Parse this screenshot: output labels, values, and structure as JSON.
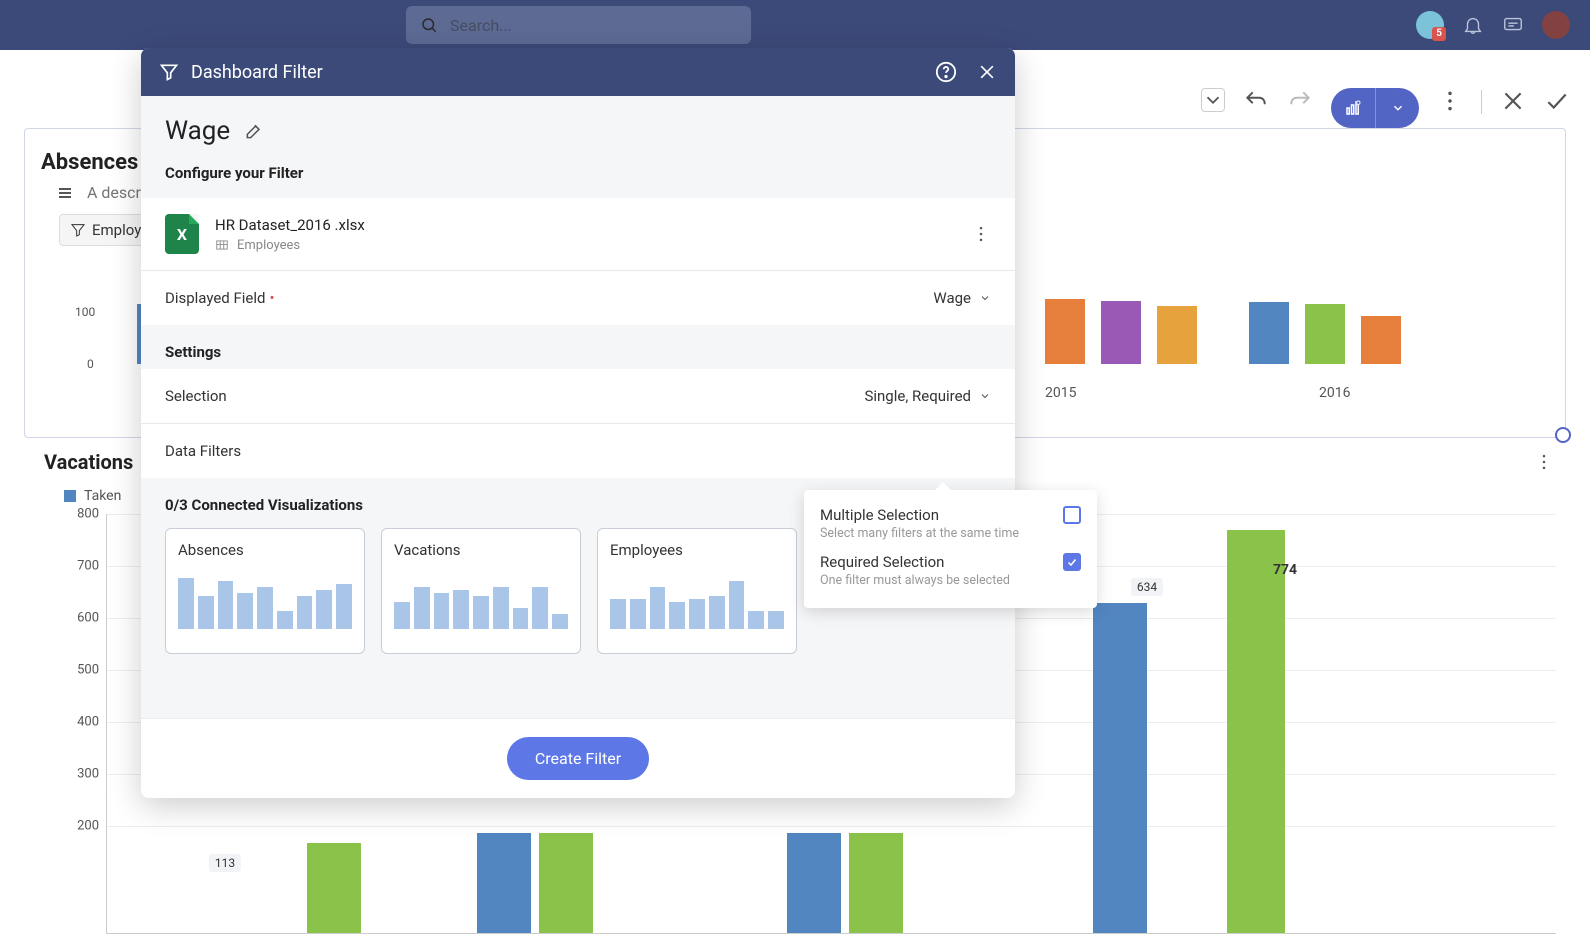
{
  "topbar": {
    "search_placeholder": "Search...",
    "badge_count": "5"
  },
  "editor_toolbar": {},
  "background": {
    "absences_title": "Absences",
    "description_placeholder": "A descrip",
    "chip_label": "Employee",
    "y100": "100",
    "y0": "0",
    "year_2015": "2015",
    "year_2016": "2016"
  },
  "vacations": {
    "title": "Vacations",
    "legend_taken": "Taken",
    "yticks": [
      "800",
      "700",
      "600",
      "500",
      "400",
      "300",
      "200"
    ],
    "label_113": "113",
    "label_634": "634",
    "label_774": "774"
  },
  "modal": {
    "header_title": "Dashboard Filter",
    "filter_name": "Wage",
    "configure_label": "Configure your Filter",
    "datasource_file": "HR Dataset_2016 .xlsx",
    "datasource_table": "Employees",
    "displayed_field_label": "Displayed Field",
    "displayed_field_value": "Wage",
    "settings_label": "Settings",
    "selection_label": "Selection",
    "selection_value": "Single, Required",
    "data_filters_label": "Data Filters",
    "connected_title": "0/3 Connected Visualizations",
    "viz": [
      "Absences",
      "Vacations",
      "Employees"
    ],
    "create_button": "Create Filter"
  },
  "popover": {
    "multi_title": "Multiple Selection",
    "multi_sub": "Select many filters at the same time",
    "req_title": "Required Selection",
    "req_sub": "One filter must always be selected"
  },
  "chart_data": [
    {
      "type": "bar",
      "title": "Absences",
      "ylim": [
        0,
        100
      ],
      "note": "Mostly obscured by modal; visible bars on left and right edges only.",
      "x_visible": [
        "2015",
        "2016"
      ]
    },
    {
      "type": "bar",
      "title": "Vacations",
      "series": [
        {
          "name": "Taken"
        }
      ],
      "ylim": [
        0,
        800
      ],
      "yticks": [
        200,
        300,
        400,
        500,
        600,
        700,
        800
      ],
      "visible_labels": [
        113,
        634,
        774
      ],
      "note": "Primary grouped bar chart; most of x-axis obscured by modal."
    }
  ]
}
